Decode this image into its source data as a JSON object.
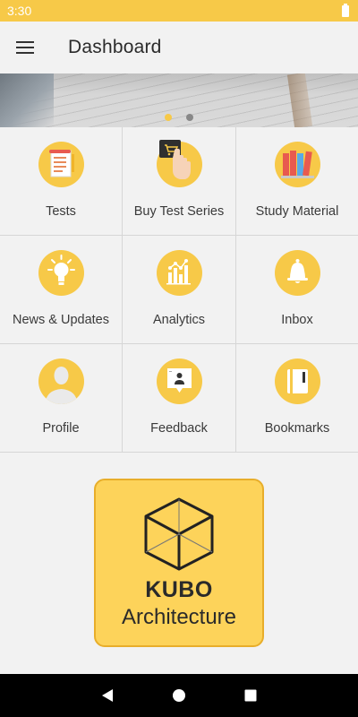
{
  "status_bar": {
    "time": "3:30",
    "battery_icon": "battery-full-icon"
  },
  "app_bar": {
    "title": "Dashboard",
    "menu_icon": "hamburger-menu-icon"
  },
  "banner": {
    "active_slide": 1,
    "slide_count": 2
  },
  "tiles": [
    {
      "label": "Tests",
      "icon": "test-paper-icon"
    },
    {
      "label": "Buy Test Series",
      "icon": "shopping-cart-tap-icon"
    },
    {
      "label": "Study Material",
      "icon": "books-icon"
    },
    {
      "label": "News & Updates",
      "icon": "lightbulb-icon"
    },
    {
      "label": "Analytics",
      "icon": "bar-chart-icon"
    },
    {
      "label": "Inbox",
      "icon": "bell-icon"
    },
    {
      "label": "Profile",
      "icon": "user-avatar-icon"
    },
    {
      "label": "Feedback",
      "icon": "feedback-icon"
    },
    {
      "label": "Bookmarks",
      "icon": "bookmark-book-icon"
    }
  ],
  "logo": {
    "name": "KUBO",
    "subtitle": "Architecture"
  },
  "nav_bar": {
    "back_icon": "back-triangle-icon",
    "home_icon": "home-circle-icon",
    "recents_icon": "recents-square-icon"
  },
  "colors": {
    "accent": "#f7c948",
    "logo_bg": "#fdd35a",
    "logo_border": "#e8ae2a",
    "dot_active": "#f7c948",
    "dot_inactive": "#888888"
  }
}
